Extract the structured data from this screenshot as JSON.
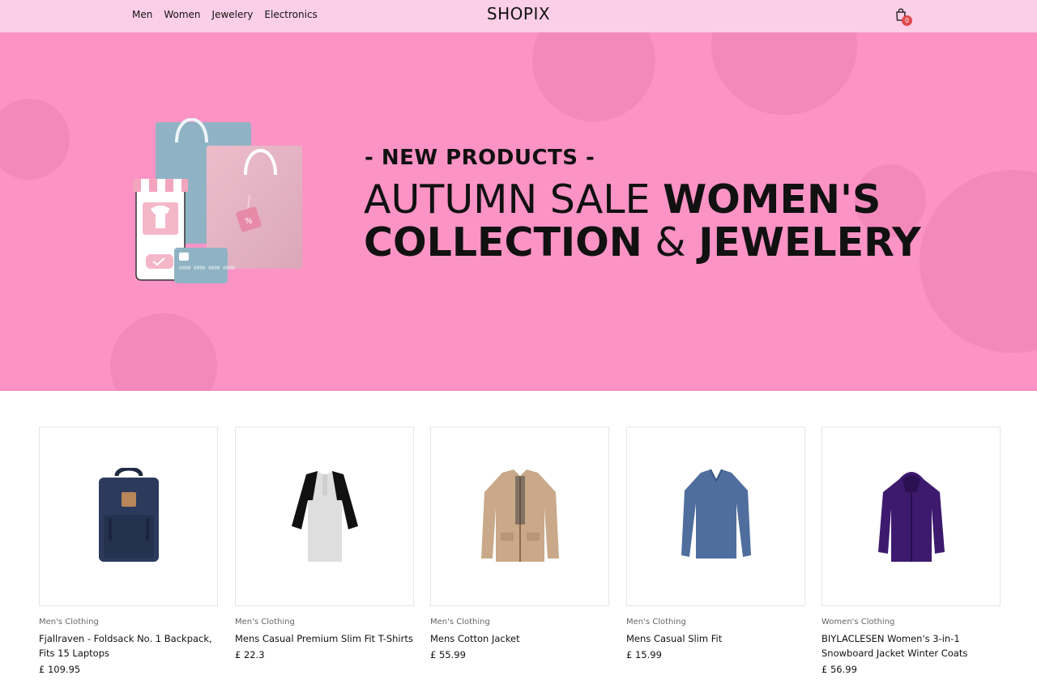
{
  "nav": {
    "links": [
      "Men",
      "Women",
      "Jewelery",
      "Electronics"
    ],
    "logo": "SHOPIX",
    "cart_count": "0"
  },
  "hero": {
    "eyebrow": "- NEW PRODUCTS -",
    "line1_light": "AUTUMN SALE ",
    "line1_bold": "WOMEN'S",
    "line2_bold_a": "COLLECTION",
    "line2_light": " & ",
    "line2_bold_b": "JEWELERY"
  },
  "products": [
    {
      "category": "Men's Clothing",
      "title": "Fjallraven - Foldsack No. 1 Backpack, Fits 15 Laptops",
      "price": "£ 109.95",
      "icon": "backpack-icon"
    },
    {
      "category": "Men's Clothing",
      "title": "Mens Casual Premium Slim Fit T-Shirts",
      "price": "£ 22.3",
      "icon": "tshirt-icon"
    },
    {
      "category": "Men's Clothing",
      "title": "Mens Cotton Jacket",
      "price": "£ 55.99",
      "icon": "jacket-icon"
    },
    {
      "category": "Men's Clothing",
      "title": "Mens Casual Slim Fit",
      "price": "£ 15.99",
      "icon": "sweater-icon"
    },
    {
      "category": "Women's Clothing",
      "title": "BIYLACLESEN Women's 3-in-1 Snowboard Jacket Winter Coats",
      "price": "£ 56.99",
      "icon": "coat-icon"
    }
  ],
  "colors": {
    "header_bg": "#fbcfe8",
    "hero_bg": "#fb93c5",
    "badge": "#e0484d"
  }
}
